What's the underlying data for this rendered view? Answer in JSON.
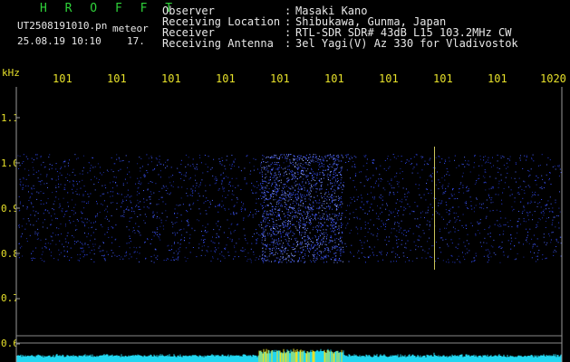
{
  "header": {
    "brand": "H R O F F T",
    "file_name": "UT2508191010.pn",
    "kind": "meteor",
    "timestamp": "25.08.19 10:10",
    "format": "17."
  },
  "meta": {
    "labels": [
      "Observer",
      "Receiving Location",
      "Receiver",
      "Receiving Antenna"
    ],
    "values": [
      "Masaki Kano",
      "Shibukawa, Gunma, Japan",
      "RTL-SDR SDR# 43dB L15 103.2MHz CW",
      "3el Yagi(V) Az 330 for Vladivostok"
    ]
  },
  "axis": {
    "unit": "kHz",
    "freq_ticks": [
      "101",
      "101",
      "101",
      "101",
      "101",
      "101",
      "101",
      "101",
      "101",
      "1020"
    ],
    "y_ticks": [
      "1.1",
      "1.0",
      "0.9",
      "0.8",
      "0.7",
      "0.6"
    ]
  },
  "colors": {
    "signal": "#2a40ff",
    "text": "#e8e8e8",
    "axis": "#e6e02a",
    "brand": "#2fd23a"
  }
}
